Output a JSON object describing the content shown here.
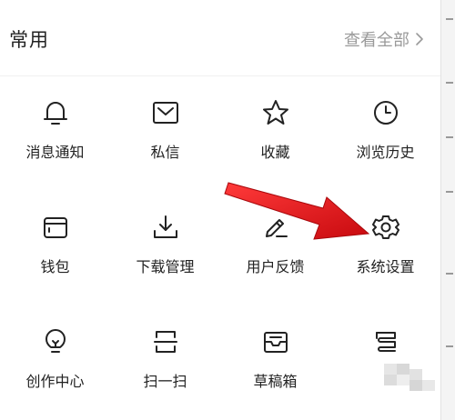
{
  "header": {
    "title": "常用",
    "view_all": "查看全部"
  },
  "grid": {
    "rows": [
      [
        {
          "label": "消息通知",
          "icon": "bell-icon"
        },
        {
          "label": "私信",
          "icon": "envelope-icon"
        },
        {
          "label": "收藏",
          "icon": "star-icon"
        },
        {
          "label": "浏览历史",
          "icon": "clock-icon"
        }
      ],
      [
        {
          "label": "钱包",
          "icon": "wallet-icon"
        },
        {
          "label": "下载管理",
          "icon": "download-icon"
        },
        {
          "label": "用户反馈",
          "icon": "pencil-icon"
        },
        {
          "label": "系统设置",
          "icon": "gear-icon"
        }
      ],
      [
        {
          "label": "创作中心",
          "icon": "lightbulb-icon"
        },
        {
          "label": "扫一扫",
          "icon": "scan-icon"
        },
        {
          "label": "草稿箱",
          "icon": "draft-box-icon"
        },
        {
          "label": "",
          "icon": "stack-icon"
        }
      ]
    ]
  },
  "annotation": {
    "arrow_color": "#e8141c",
    "points_to": "系统设置"
  }
}
